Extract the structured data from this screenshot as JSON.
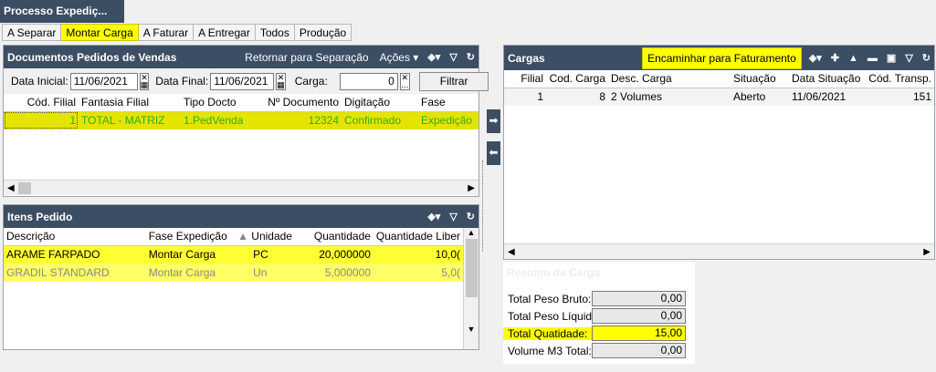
{
  "window": {
    "title": "Processo Expediç..."
  },
  "tabs": [
    "A Separar",
    "Montar Carga",
    "A Faturar",
    "A Entregar",
    "Todos",
    "Produção"
  ],
  "documents": {
    "title": "Documentos Pedidos de Vendas",
    "return_label": "Retornar para Separação",
    "actions_label": "Ações",
    "filter": {
      "start_label": "Data Inicial:",
      "start_value": "11/06/2021",
      "end_label": "Data Final:",
      "end_value": "11/06/2021",
      "load_label": "Carga:",
      "load_value": "0",
      "filter_button": "Filtrar"
    },
    "columns": [
      "Cód. Filial",
      "Fantasia Filial",
      "Tipo Docto",
      "Nº Documento",
      "Digitação",
      "Fase"
    ],
    "rows": [
      [
        "1",
        "TOTAL - MATRIZ",
        "1.PedVenda",
        "12324",
        "Confirmado",
        "Expedição"
      ]
    ]
  },
  "items": {
    "title": "Itens Pedido",
    "columns": [
      "Descrição",
      "Fase Expedição",
      "Unidade",
      "Quantidade",
      "Quantidade Liber"
    ],
    "rows": [
      [
        "ARAME FARPADO",
        "Montar Carga",
        "PC",
        "20,000000",
        "10,0("
      ],
      [
        "GRADIL STANDARD",
        "Montar Carga",
        "Un",
        "5,000000",
        "5,0("
      ]
    ]
  },
  "cargas": {
    "title": "Cargas",
    "forward_button": "Encaminhar para Faturamento",
    "columns": [
      "Filial",
      "Cod. Carga",
      "Desc. Carga",
      "Situação",
      "Data Situação",
      "Cód. Transp."
    ],
    "rows": [
      [
        "1",
        "8",
        "2 Volumes",
        "Aberto",
        "11/06/2021",
        "151"
      ]
    ]
  },
  "summary": {
    "title": "Resumo da Carga",
    "rows": [
      {
        "label": "Total Peso Bruto:",
        "value": "0,00"
      },
      {
        "label": "Total Peso Líquido:",
        "value": "0,00"
      },
      {
        "label": "Total Quatidade:",
        "value": "15,00"
      },
      {
        "label": "Volume M3 Total:",
        "value": "0,00"
      }
    ]
  },
  "icons": {
    "view": "view-options-icon",
    "filter": "filter-icon",
    "refresh": "refresh-icon",
    "add": "add-icon",
    "up": "arrow-up-icon",
    "remove": "minus-icon",
    "save": "save-icon",
    "move_right": "arrow-right-icon",
    "move_left": "arrow-left-icon"
  },
  "colors": {
    "header": "#3c4e64",
    "highlight": "#ffff00",
    "selected_text": "#2cb01e"
  }
}
